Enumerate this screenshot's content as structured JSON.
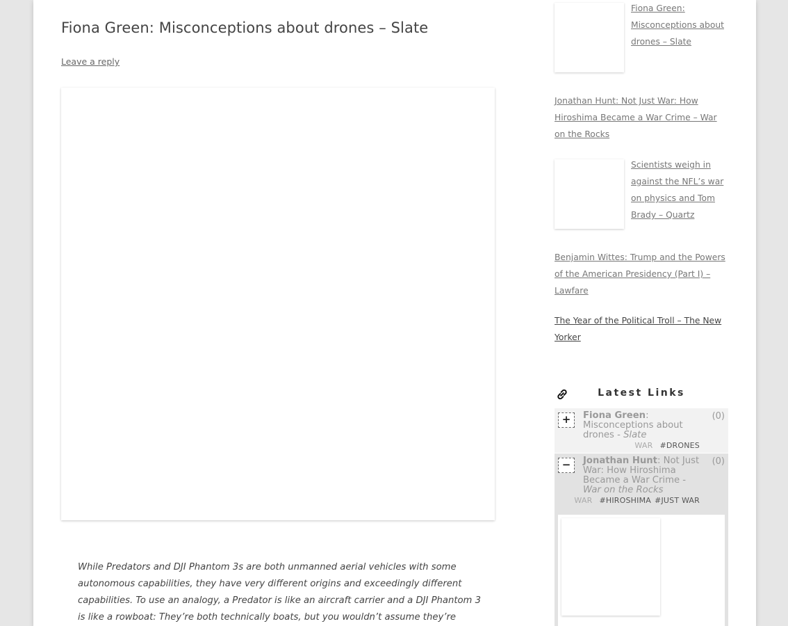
{
  "post": {
    "title": "Fiona Green: Misconceptions about drones – Slate",
    "leave_reply": "Leave a reply",
    "quote": "While Predators and DJI Phantom 3s are both unmanned aerial vehicles with some autonomous capabilities, they have very different origins and exceedingly different capabilities. To use an analogy, a Predator is like an aircraft carrier and a DJI Phantom 3 is like a rowboat: They’re both technically boats, but you wouldn’t assume they’re capable of the"
  },
  "related_posts": [
    {
      "title": "Fiona Green: Misconceptions about drones – Slate",
      "has_thumb": true
    },
    {
      "title": "Jonathan Hunt: Not Just War: How Hiroshima Became a War Crime – War on the Rocks",
      "has_thumb": false
    },
    {
      "title": "Scientists weigh in against the NFL’s war on physics and Tom Brady – Quartz",
      "has_thumb": true
    },
    {
      "title": "Benjamin Wittes: Trump and the Powers of the American Presidency (Part I) – Lawfare",
      "has_thumb": false
    },
    {
      "title": "The Year of the Political Troll – The New Yorker",
      "has_thumb": false
    }
  ],
  "latest_links": {
    "title": "Latest Links",
    "items": [
      {
        "toggle": "+",
        "author": "Fiona Green",
        "sep": ":",
        "text": " Misconceptions about drones - ",
        "source": "Slate",
        "count": "(0)",
        "category": "WAR",
        "tags": [
          "#DRONES"
        ]
      },
      {
        "toggle": "−",
        "author": "Jonathan Hunt",
        "sep": ":",
        "text": " Not Just War: How Hiroshima Became a War Crime - ",
        "source": "War on the Rocks",
        "count": "(0)",
        "category": "WAR",
        "tags": [
          "#HIROSHIMA",
          "#JUST WAR"
        ]
      }
    ]
  },
  "icons": {
    "link_icon": "chain-link-icon"
  }
}
